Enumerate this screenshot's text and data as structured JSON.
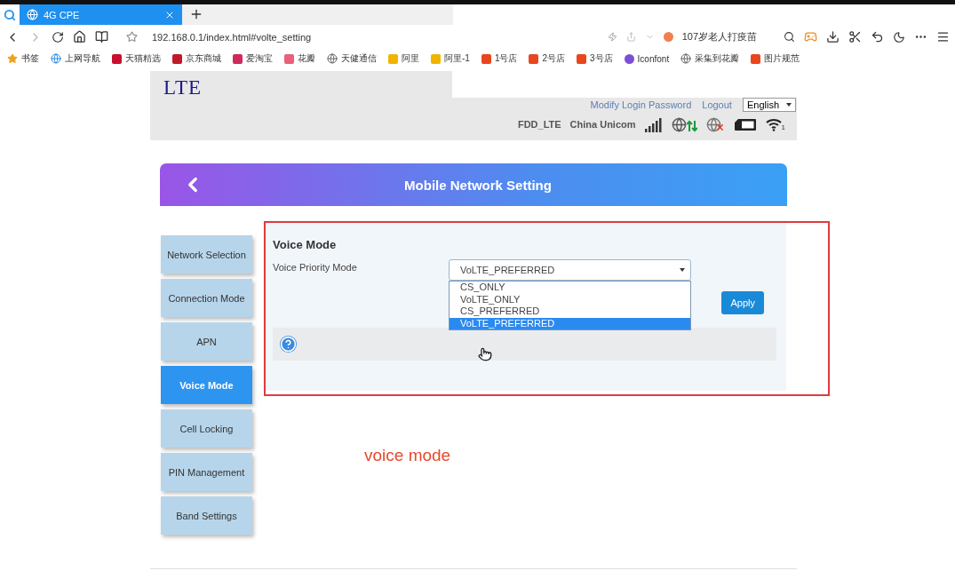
{
  "browser": {
    "tabs": [
      {
        "label": "4G CPE",
        "selected": true
      }
    ],
    "address": "192.168.0.1/index.html#volte_setting",
    "news_hint": "107岁老人打疫苗",
    "bookmarks": [
      {
        "label": "书签",
        "kind": "star",
        "color": "#f0a020"
      },
      {
        "label": "上网导航",
        "kind": "ie"
      },
      {
        "label": "天猫精选",
        "kind": "tile",
        "color": "#c8102e"
      },
      {
        "label": "京东商城",
        "kind": "tile",
        "color": "#c0192a"
      },
      {
        "label": "爱淘宝",
        "kind": "tile",
        "color": "#d02a5c"
      },
      {
        "label": "花瓣",
        "kind": "tile",
        "color": "#e8607a"
      },
      {
        "label": "天健通信",
        "kind": "globe"
      },
      {
        "label": "阿里",
        "kind": "tile",
        "color": "#f0b400"
      },
      {
        "label": "阿里-1",
        "kind": "tile",
        "color": "#f0b400"
      },
      {
        "label": "1号店",
        "kind": "tile",
        "color": "#e8461e"
      },
      {
        "label": "2号店",
        "kind": "tile",
        "color": "#e8461e"
      },
      {
        "label": "3号店",
        "kind": "tile",
        "color": "#e8461e"
      },
      {
        "label": "Iconfont",
        "kind": "round",
        "color": "#7b4fd6"
      },
      {
        "label": "采集到花瓣",
        "kind": "globe"
      },
      {
        "label": "图片规范",
        "kind": "tile",
        "color": "#e8461e"
      }
    ]
  },
  "header": {
    "logo": "LTE",
    "links": [
      "Modify Login Password",
      "Logout"
    ],
    "language": "English",
    "network_type": "FDD_LTE",
    "operator": "China Unicom",
    "wifi_clients": "1"
  },
  "page_title": "Mobile Network Setting",
  "sidebar": {
    "items": [
      {
        "label": "Network Selection",
        "selected": false
      },
      {
        "label": "Connection Mode",
        "selected": false
      },
      {
        "label": "APN",
        "selected": false
      },
      {
        "label": "Voice Mode",
        "selected": true
      },
      {
        "label": "Cell Locking",
        "selected": false
      },
      {
        "label": "PIN Management",
        "selected": false
      },
      {
        "label": "Band Settings",
        "selected": false
      }
    ]
  },
  "panel": {
    "title": "Voice Mode",
    "field_label": "Voice Priority Mode",
    "value": "VoLTE_PREFERRED",
    "expanded": true,
    "options": [
      {
        "label": "CS_ONLY",
        "selected": false
      },
      {
        "label": "VoLTE_ONLY",
        "selected": false
      },
      {
        "label": "CS_PREFERRED",
        "selected": false
      },
      {
        "label": "VoLTE_PREFERRED",
        "selected": true
      }
    ],
    "button": "Apply"
  },
  "annotation": {
    "text": "voice mode"
  }
}
